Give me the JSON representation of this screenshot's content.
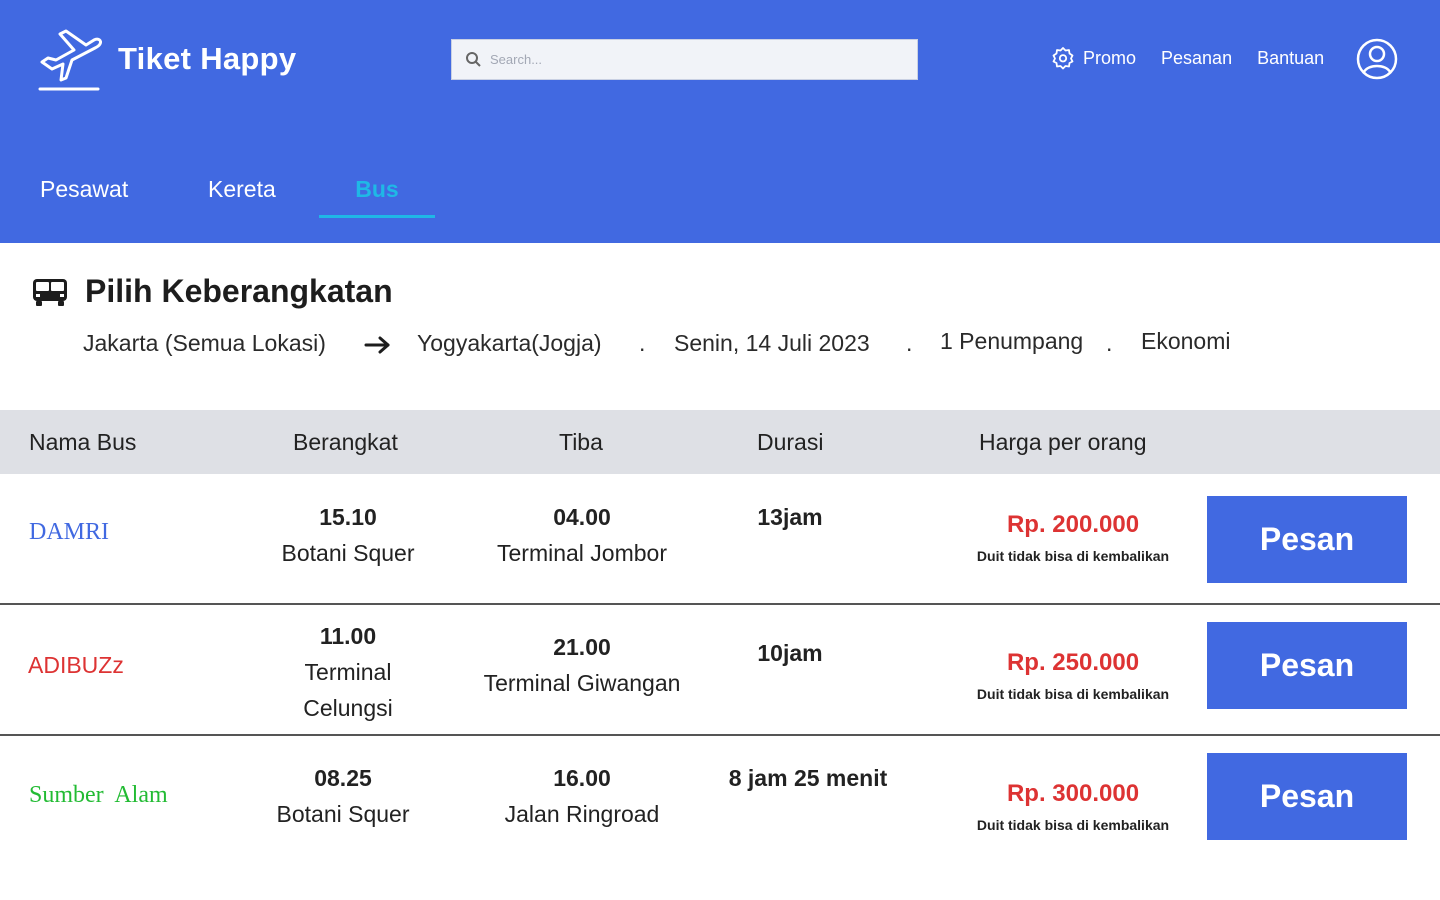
{
  "app": {
    "name": "Tiket Happy"
  },
  "search": {
    "placeholder": "Search..."
  },
  "nav": {
    "promo": "Promo",
    "pesanan": "Pesanan",
    "bantuan": "Bantuan"
  },
  "tabs": [
    {
      "label": "Pesawat",
      "active": false
    },
    {
      "label": "Kereta",
      "active": false
    },
    {
      "label": "Bus",
      "active": true
    }
  ],
  "section": {
    "title": "Pilih Keberangkatan",
    "from": "Jakarta (Semua Lokasi)",
    "to": "Yogyakarta(Jogja)",
    "separator": ".",
    "date": "Senin, 14 Juli 2023",
    "passengers": "1 Penumpang",
    "class": "Ekonomi"
  },
  "table": {
    "headers": [
      "Nama Bus",
      "Berangkat",
      "Tiba",
      "Durasi",
      "Harga per orang"
    ],
    "rows": [
      {
        "name": "DAMRI",
        "depart_time": "15.10",
        "depart_place": "Botani Squer",
        "arrive_time": "04.00",
        "arrive_place": "Terminal Jombor",
        "duration": "13jam",
        "price": "Rp. 200.000",
        "note": "Duit tidak bisa di kembalikan",
        "button": "Pesan"
      },
      {
        "name": "ADIBUZz",
        "depart_time": "11.00",
        "depart_place": "Terminal Celungsi",
        "arrive_time": "21.00",
        "arrive_place": "Terminal Giwangan",
        "duration": "10jam",
        "price": "Rp. 250.000",
        "note": "Duit tidak bisa di kembalikan",
        "button": "Pesan"
      },
      {
        "name": "Sumber Alam",
        "depart_time": "08.25",
        "depart_place": "Botani Squer",
        "arrive_time": "16.00",
        "arrive_place": "Jalan Ringroad",
        "duration": "8 jam 25 menit",
        "price": "Rp. 300.000",
        "note": "Duit tidak bisa di kembalikan",
        "button": "Pesan"
      }
    ]
  },
  "colors": {
    "primary": "#4169E1",
    "active_tab": "#1fb8e6",
    "price": "#dd3333",
    "header_row": "#dee0e5"
  },
  "icons": {
    "logo": "plane-takeoff-icon",
    "search": "search-icon",
    "promo": "badge-percent-icon",
    "profile": "user-circle-icon",
    "bus": "bus-icon",
    "arrow": "arrow-right-icon"
  }
}
